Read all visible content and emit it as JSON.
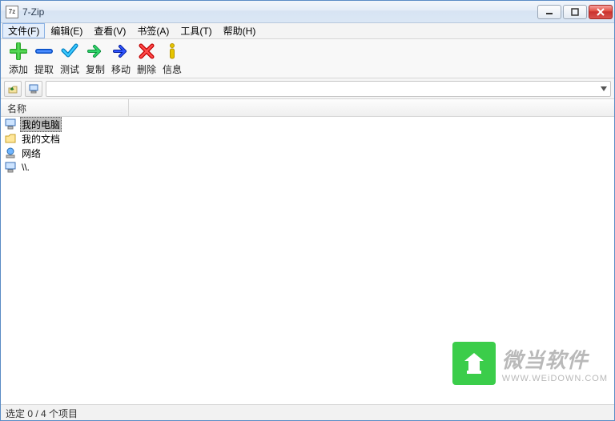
{
  "window": {
    "title": "7-Zip",
    "app_icon_text": "7z"
  },
  "menu": {
    "file": "文件(F)",
    "edit": "编辑(E)",
    "view": "查看(V)",
    "bookmarks": "书签(A)",
    "tools": "工具(T)",
    "help": "帮助(H)"
  },
  "toolbar": {
    "add": "添加",
    "extract": "提取",
    "test": "测试",
    "copy": "复制",
    "move": "移动",
    "delete": "删除",
    "info": "信息"
  },
  "columns": {
    "name": "名称"
  },
  "items": [
    {
      "label": "我的电脑",
      "icon": "computer"
    },
    {
      "label": "我的文档",
      "icon": "folder"
    },
    {
      "label": "网络",
      "icon": "network"
    },
    {
      "label": "\\\\.",
      "icon": "computer"
    }
  ],
  "status": "选定 0 / 4 个项目",
  "watermark": {
    "cn": "微当软件",
    "url": "WWW.WEiDOWN.COM"
  }
}
